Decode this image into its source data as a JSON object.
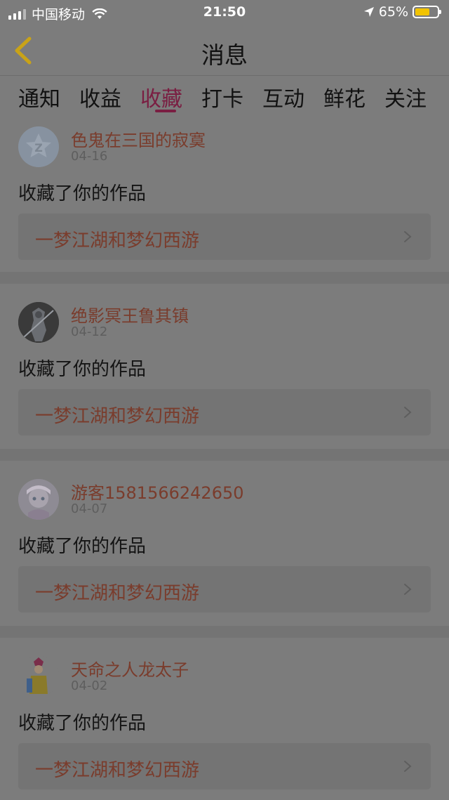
{
  "status_bar": {
    "carrier": "中国移动",
    "time": "21:50",
    "battery_percent": "65%",
    "battery_level": 0.65
  },
  "header": {
    "title": "消息",
    "back_icon": "chevron-left-icon"
  },
  "tabs": [
    {
      "label": "通知"
    },
    {
      "label": "收益"
    },
    {
      "label": "收藏"
    },
    {
      "label": "打卡"
    },
    {
      "label": "互动"
    },
    {
      "label": "鲜花"
    },
    {
      "label": "关注"
    }
  ],
  "active_tab": "收藏",
  "notifications": [
    {
      "user": "色鬼在三国的寂寞",
      "date": "04-16",
      "action": "收藏了你的作品",
      "work": "一梦江湖和梦幻西游"
    },
    {
      "user": "绝影冥王鲁其镇",
      "date": "04-12",
      "action": "收藏了你的作品",
      "work": "一梦江湖和梦幻西游"
    },
    {
      "user": "游客1581566242650",
      "date": "04-07",
      "action": "收藏了你的作品",
      "work": "一梦江湖和梦幻西游"
    },
    {
      "user": "天命之人龙太子",
      "date": "04-02",
      "action": "收藏了你的作品",
      "work": "一梦江湖和梦幻西游"
    }
  ],
  "colors": {
    "accent": "#7a1e42",
    "username": "#7a3c2c",
    "overlay_background": "#7c7c7c"
  }
}
